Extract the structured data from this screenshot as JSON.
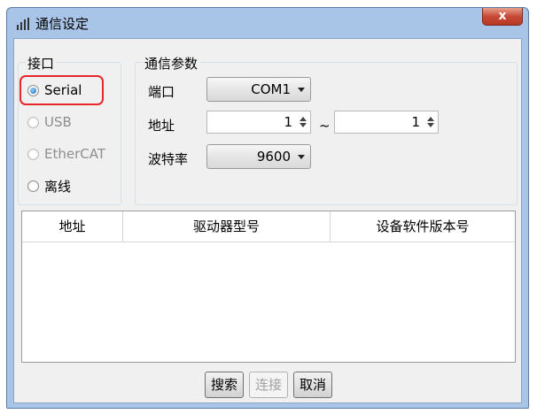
{
  "window": {
    "title": "通信设定",
    "close_label": "x"
  },
  "interface_group": {
    "legend": "接口",
    "options": [
      {
        "label": "Serial",
        "checked": true,
        "enabled": true
      },
      {
        "label": "USB",
        "checked": false,
        "enabled": false
      },
      {
        "label": "EtherCAT",
        "checked": false,
        "enabled": false
      },
      {
        "label": "离线",
        "checked": false,
        "enabled": true
      }
    ]
  },
  "params_group": {
    "legend": "通信参数",
    "port_label": "端口",
    "port_value": "COM1",
    "address_label": "地址",
    "address_from": "1",
    "address_sep": "~",
    "address_to": "1",
    "baud_label": "波特率",
    "baud_value": "9600"
  },
  "table": {
    "columns": [
      "地址",
      "驱动器型号",
      "设备软件版本号"
    ]
  },
  "buttons": {
    "search": "搜索",
    "connect": "连接",
    "cancel": "取消"
  },
  "colors": {
    "highlight": "#e8262b",
    "title_bar": "#a8c4e6"
  }
}
